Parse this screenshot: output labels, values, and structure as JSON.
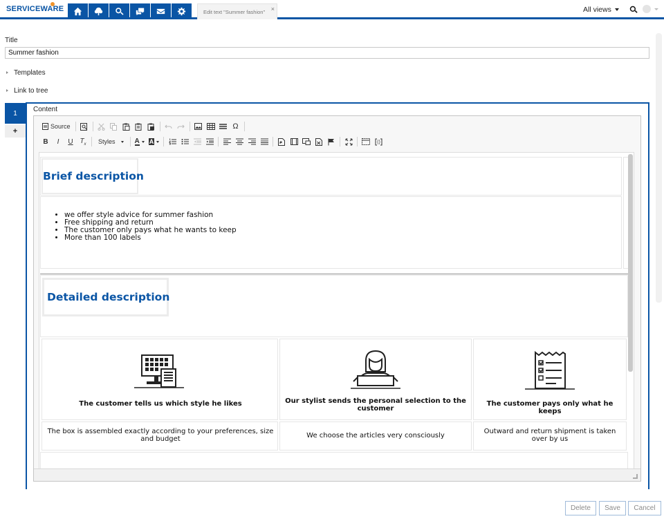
{
  "app": {
    "logo_text": "SERVICEWARE",
    "tab_label": "Edit text \"Summer fashion\"",
    "tab_close": "×",
    "view_selector": "All views",
    "nav_icons": [
      "home-icon",
      "tree-icon",
      "search-icon",
      "chat-icon",
      "mail-icon",
      "gear-icon"
    ]
  },
  "form": {
    "title_label": "Title",
    "title_value": "Summer fashion",
    "templates_label": "Templates",
    "link_label": "Link to tree",
    "content_label": "Content",
    "tab_number": "1",
    "add_tab": "+"
  },
  "toolbar": {
    "source_label": "Source",
    "styles_label": "Styles"
  },
  "document": {
    "brief_heading": "Brief description",
    "bullets": [
      "we offer style advice for summer fashion",
      "Free shipping and return",
      "The customer only pays what he wants to keep",
      "More than 100 labels"
    ],
    "detailed_heading": "Detailed description",
    "steps": [
      {
        "title": "The customer tells us which style he likes",
        "desc": "The box is assembled exactly according to your preferences, size and budget",
        "icon": "monitor-icon"
      },
      {
        "title": "Our stylist sends the personal selection to the customer",
        "desc": "We choose the articles very consciously",
        "icon": "stylist-icon"
      },
      {
        "title": "The customer pays only what he keeps",
        "desc": "Outward and return shipment is taken over by us",
        "icon": "receipt-icon"
      }
    ]
  },
  "actions": {
    "delete": "Delete",
    "save": "Save",
    "cancel": "Cancel"
  },
  "colors": {
    "brand": "#0a55a5",
    "accent_orange": "#f0942b"
  }
}
